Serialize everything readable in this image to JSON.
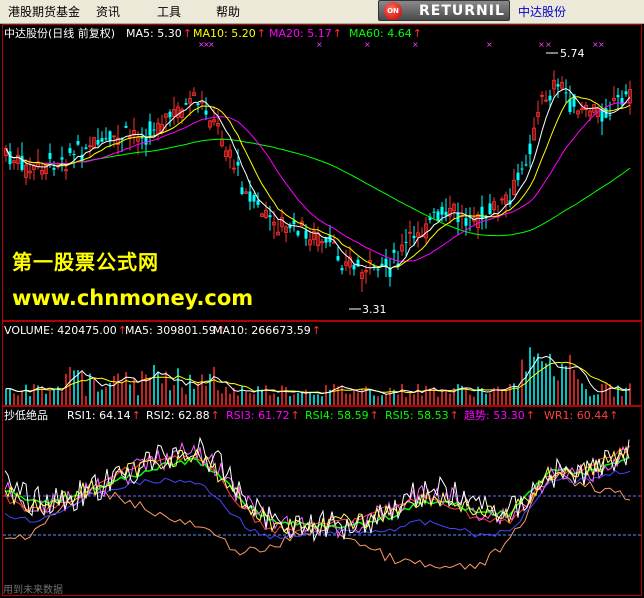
{
  "menu": {
    "items": [
      "港股期货基金",
      "资讯",
      "工具",
      "帮助"
    ],
    "returnil_label": "RETURNIL",
    "returnil_icon_text": "ON",
    "stock_link": "中达股份"
  },
  "main_panel": {
    "title": "中达股份(日线 前复权)",
    "indicators": [
      {
        "text": "MA5: 5.30",
        "color": "#ffffff"
      },
      {
        "text": "MA10: 5.20",
        "color": "#ffff00"
      },
      {
        "text": "MA20: 5.17",
        "color": "#ff00ff"
      },
      {
        "text": "MA60: 4.64",
        "color": "#00ff00"
      }
    ],
    "high_label": "5.74",
    "low_label": "3.31"
  },
  "volume_panel": {
    "indicators": [
      {
        "text": "VOLUME: 420475.00",
        "color": "#ffffff"
      },
      {
        "text": "MA5: 309801.59",
        "color": "#ffffff"
      },
      {
        "text": "MA10: 266673.59",
        "color": "#ffffff"
      }
    ]
  },
  "rsi_panel": {
    "title": "抄低绝品",
    "indicators": [
      {
        "text": "RSI1: 64.14",
        "color": "#ffffff"
      },
      {
        "text": "RSI2: 62.88",
        "color": "#ffffff"
      },
      {
        "text": "RSI3: 61.72",
        "color": "#ff00ff"
      },
      {
        "text": "RSI4: 58.59",
        "color": "#00ff00"
      },
      {
        "text": "RSI5: 58.53",
        "color": "#00ff00"
      },
      {
        "text": "趋势: 53.30",
        "color": "#ff00ff"
      },
      {
        "text": "WR1: 60.44",
        "color": "#ff4040"
      }
    ]
  },
  "watermark": {
    "line1": "第一股票公式网",
    "line2": "www.chnmoney.com"
  },
  "footer_note": "用到未来数据",
  "colors": {
    "up": "#ff3030",
    "down": "#00ffff",
    "ma5": "#ffffff",
    "ma10": "#ffff00",
    "ma20": "#ff00ff",
    "ma60": "#00ff00",
    "frame": "#b00000"
  }
}
